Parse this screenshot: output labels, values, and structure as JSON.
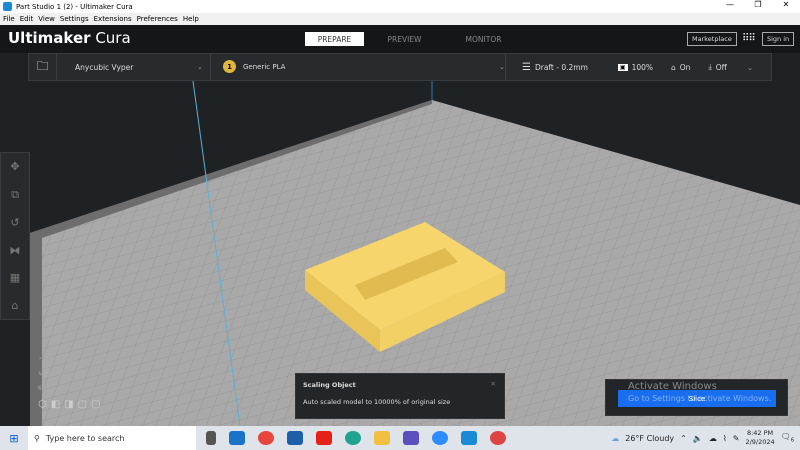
{
  "window": {
    "title": "Part Studio 1 (2) - Ultimaker Cura",
    "minimize": "—",
    "restore": "❐",
    "close": "✕"
  },
  "menu": [
    "File",
    "Edit",
    "View",
    "Settings",
    "Extensions",
    "Preferences",
    "Help"
  ],
  "header": {
    "logo_bold": "Ultimaker",
    "logo_light": "Cura",
    "tabs": [
      "PREPARE",
      "PREVIEW",
      "MONITOR"
    ],
    "active_tab": "PREPARE",
    "marketplace": "Marketplace",
    "signin": "Sign in"
  },
  "toolbar": {
    "printer": "Anycubic Vyper",
    "material_number": "1",
    "material": "Generic PLA",
    "profile": "Draft - 0.2mm",
    "infill": "100%",
    "support": "On",
    "adhesion": "Off"
  },
  "object_list": {
    "label": "Object list",
    "name": "Part Studio 1 (2)",
    "dimensions": "61.0 x 50.8 x 9.5 mm"
  },
  "toast": {
    "title": "Scaling Object",
    "message": "Auto scaled model to 10000% of original size"
  },
  "slice": {
    "label": "Slice"
  },
  "watermark": {
    "line1": "Activate Windows",
    "line2": "Go to Settings to activate Windows."
  },
  "taskbar": {
    "search_placeholder": "Type here to search",
    "weather": "26°F  Cloudy",
    "time": "8:42 PM",
    "date": "2/9/2024",
    "notifications": "6"
  },
  "colors": {
    "accent": "#196ef0",
    "model": "#f5d36a",
    "plate": "#a9a9a9"
  }
}
